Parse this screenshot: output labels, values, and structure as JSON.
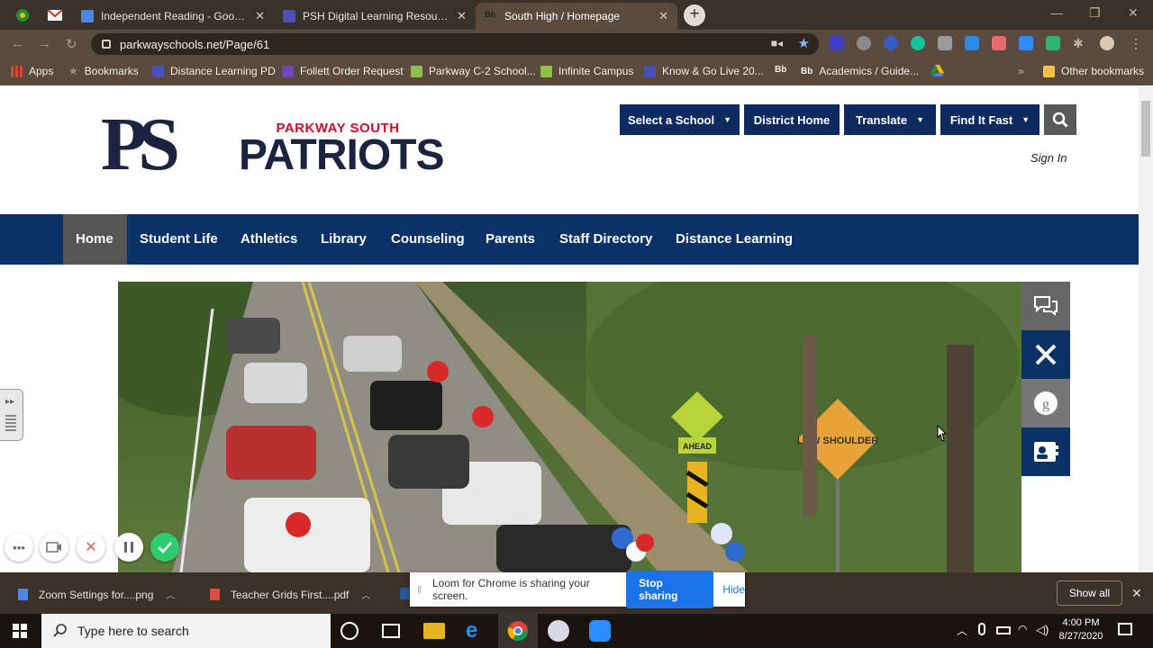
{
  "browser": {
    "tabs": [
      {
        "title": "Independent Reading - Google D",
        "favicon_color": "#4a87e8"
      },
      {
        "title": "PSH Digital Learning Resources",
        "favicon_color": "#4b4fb8"
      },
      {
        "title": "South High / Homepage",
        "favicon_label": "Bb",
        "active": true
      }
    ],
    "new_tab_label": "+",
    "window_controls": [
      "—",
      "❐",
      "✕"
    ],
    "url": "parkwayschools.net/Page/61",
    "bookmarks": [
      {
        "label": "Apps",
        "icon": "apps-grid-icon"
      },
      {
        "label": "Bookmarks",
        "icon": "star-icon"
      },
      {
        "label": "Distance Learning PD",
        "icon": "forms-icon"
      },
      {
        "label": "Follett Order Request",
        "icon": "forms-icon"
      },
      {
        "label": "Parkway C-2 School...",
        "icon": "classroom-icon"
      },
      {
        "label": "Infinite Campus",
        "icon": "classroom-icon"
      },
      {
        "label": "Know & Go Live 20...",
        "icon": "forms-icon"
      },
      {
        "label": "Bb",
        "icon": "blackboard-icon"
      },
      {
        "label": "Academics / Guide...",
        "icon": "blackboard-icon"
      },
      {
        "label": "",
        "icon": "drive-icon"
      },
      {
        "label": "»",
        "icon": "chevron-icon"
      },
      {
        "label": "Other bookmarks",
        "icon": "folder-icon"
      }
    ]
  },
  "site": {
    "logo_letters": "PS",
    "logo_school": "PARKWAY SOUTH",
    "logo_mascot": "PATRIOTS",
    "top_nav": [
      {
        "label": "Select a School",
        "dropdown": true
      },
      {
        "label": "District Home",
        "dropdown": false
      },
      {
        "label": "Translate",
        "dropdown": true
      },
      {
        "label": "Find It Fast",
        "dropdown": true
      }
    ],
    "sign_in": "Sign In",
    "main_nav": [
      "Home",
      "Student Life",
      "Athletics",
      "Library",
      "Counseling",
      "Parents",
      "Staff Directory",
      "Distance Learning"
    ],
    "active_nav": "Home",
    "hero_signs": [
      "LOW SHOULDER",
      "AHEAD"
    ],
    "side_buttons": [
      "chat-icon",
      "dining-icon",
      "google-icon",
      "contact-card-icon"
    ]
  },
  "downloads": {
    "items": [
      {
        "name": "Zoom Settings for....png"
      },
      {
        "name": "Teacher Grids First....pdf"
      }
    ],
    "show_all": "Show all"
  },
  "share_bar": {
    "message": "Loom for Chrome is sharing your screen.",
    "stop_label": "Stop sharing",
    "hide_label": "Hide"
  },
  "taskbar": {
    "search_placeholder": "Type here to search",
    "time": "4:00 PM",
    "date": "8/27/2020"
  },
  "colors": {
    "navy": "#0d2b5e",
    "main_nav": "#0a3266",
    "logo_red": "#c8102e",
    "loom_green": "#2ecc71",
    "stop_blue": "#1a73e8"
  }
}
